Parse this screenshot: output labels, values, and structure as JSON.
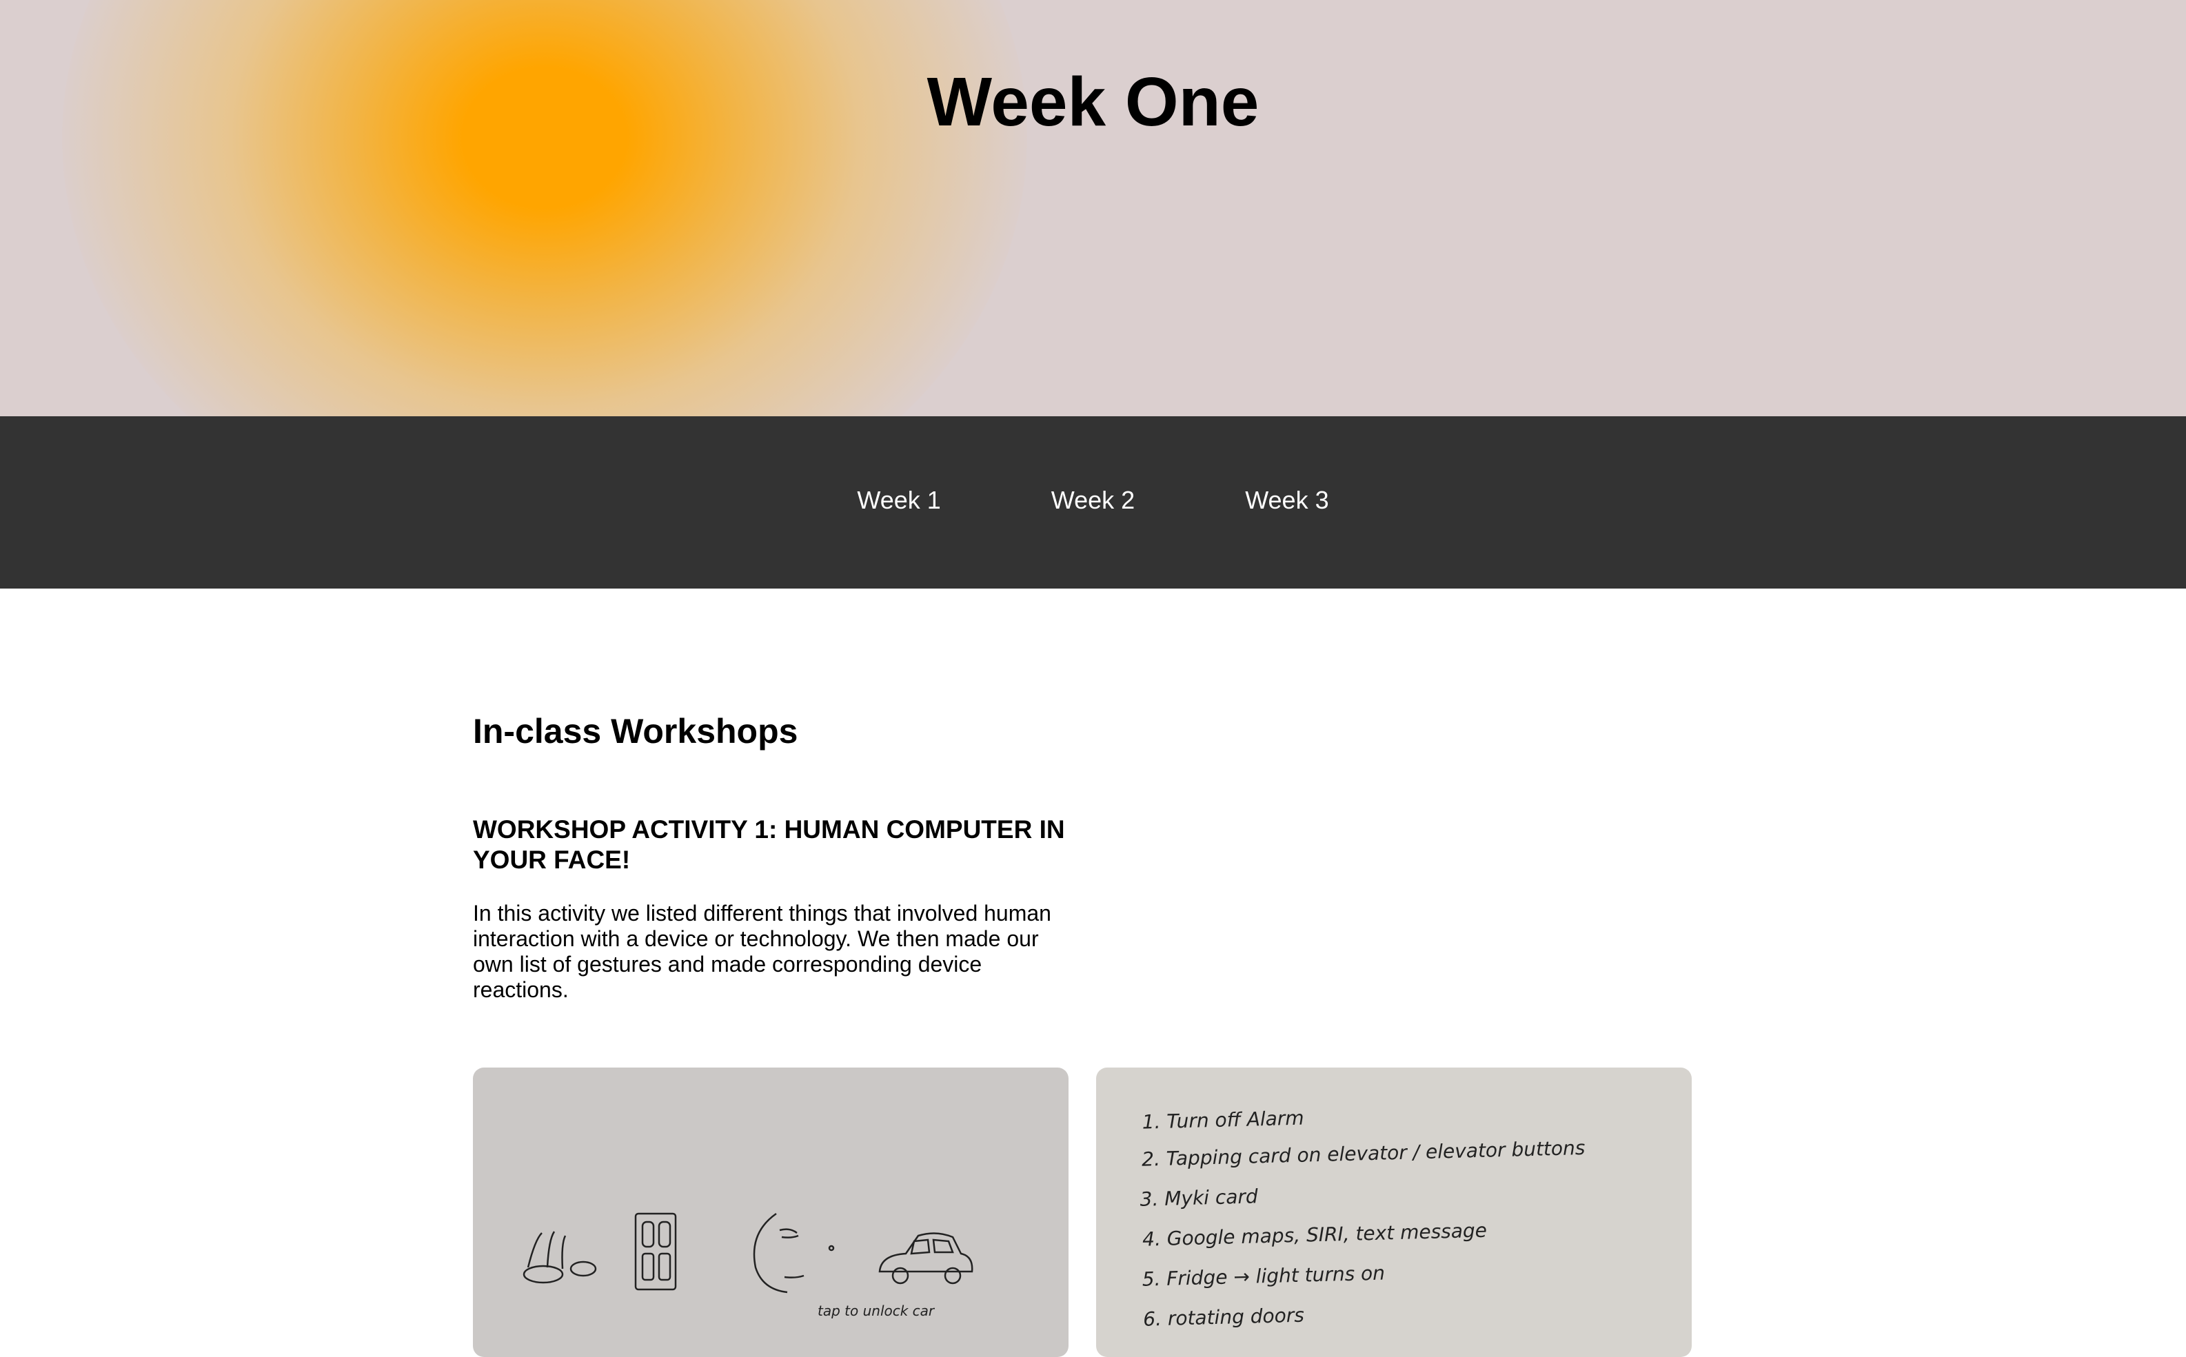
{
  "header": {
    "title": "Week One",
    "glow_color": "#ffa500",
    "background_color": "#dbcfcf"
  },
  "nav": {
    "background_color": "#333333",
    "items": [
      {
        "label": "Week 1"
      },
      {
        "label": "Week 2"
      },
      {
        "label": "Week 3"
      }
    ]
  },
  "main": {
    "section_title": "In-class Workshops",
    "activity": {
      "title": "WORKSHOP ACTIVITY 1: HUMAN COMPUTER IN YOUR FACE!",
      "description": "In this activity we listed different things that involved human interaction with a device or technology. We then made our own list of gestures and made corresponding device reactions."
    },
    "photos": {
      "left": {
        "captions": [
          "tap to unlock car"
        ]
      },
      "right": {
        "list": [
          "1. Turn off Alarm",
          "2. Tapping card on elevator / elevator buttons",
          "3. Myki card",
          "4. Google maps, SIRI, text message",
          "5. Fridge → light turns on",
          "6. rotating doors"
        ]
      }
    }
  }
}
